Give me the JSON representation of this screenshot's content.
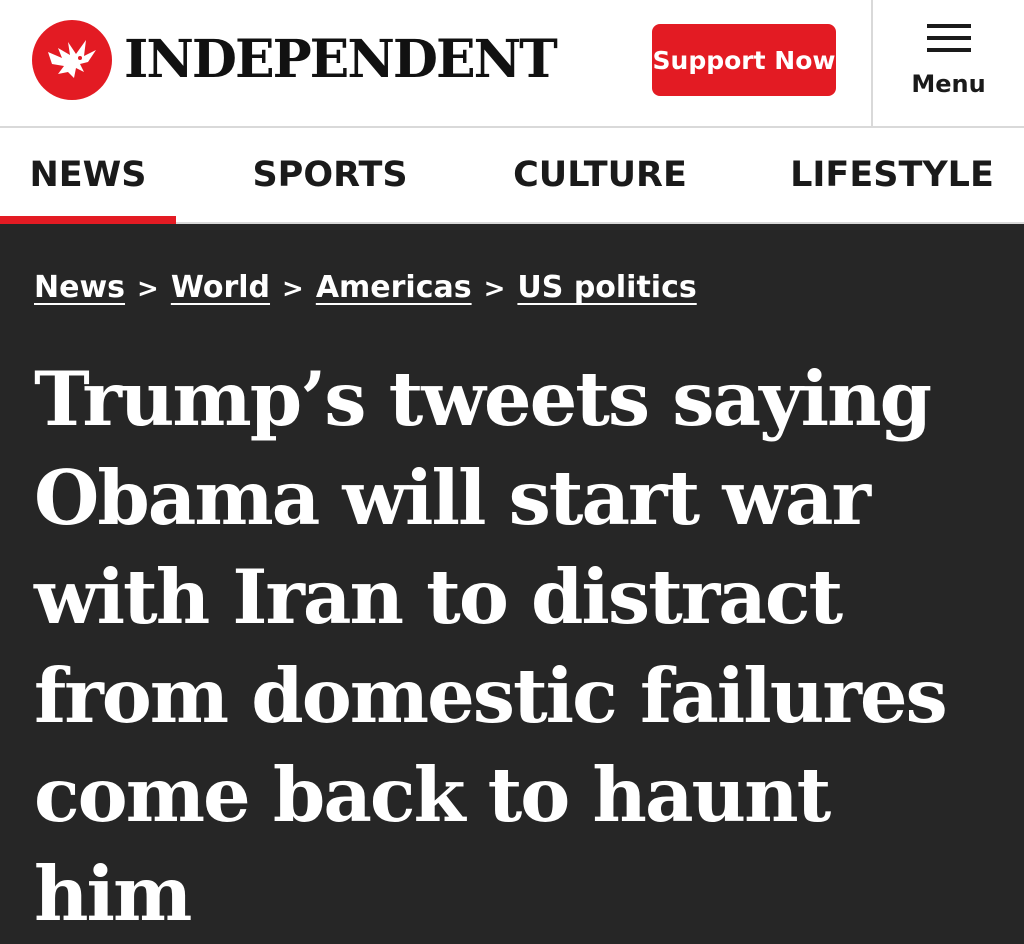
{
  "header": {
    "logo_text": "INDEPENDENT",
    "logo_icon": "eagle-icon",
    "support_label": "Support Now",
    "menu_label": "Menu",
    "menu_icon": "hamburger-icon"
  },
  "nav": {
    "items": [
      {
        "label": "NEWS",
        "active": true
      },
      {
        "label": "SPORTS",
        "active": false
      },
      {
        "label": "CULTURE",
        "active": false
      },
      {
        "label": "LIFESTYLE",
        "active": false
      }
    ]
  },
  "breadcrumb": {
    "items": [
      "News",
      "World",
      "Americas",
      "US politics"
    ],
    "separator": ">"
  },
  "article": {
    "headline": "Trump’s tweets saying Obama will start war with Iran to distract from domestic failures come back to haunt him"
  },
  "colors": {
    "brand_red": "#e31b23",
    "hero_background": "#262626",
    "text_dark": "#1a1a1a"
  }
}
